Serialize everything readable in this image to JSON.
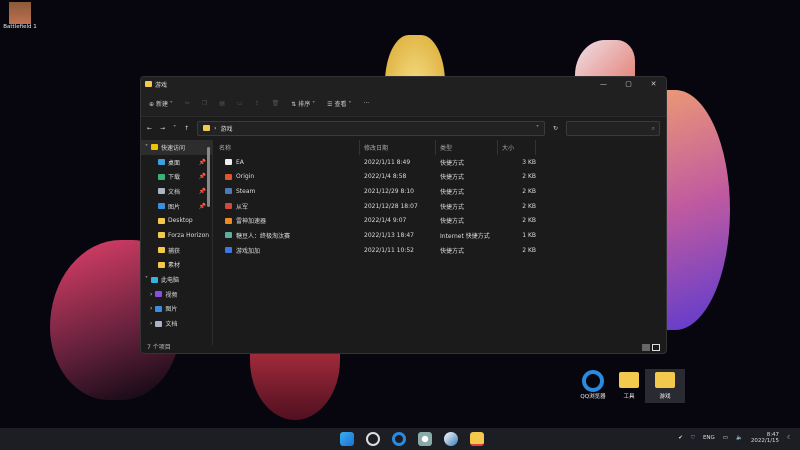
{
  "desktop": {
    "icons": [
      {
        "label": "Battlefield 1"
      },
      {
        "label": "QQ浏览器"
      },
      {
        "label": "工具"
      },
      {
        "label": "游戏"
      }
    ]
  },
  "window": {
    "title": "游戏",
    "controls": [
      "—",
      "▢",
      "✕"
    ]
  },
  "toolbar": {
    "new": "新建",
    "sort": "排序",
    "view": "查看",
    "more": "···"
  },
  "address": {
    "path": "游戏",
    "search_placeholder": ""
  },
  "sidebar": {
    "items": [
      {
        "label": "快速访问",
        "color": "#f2c200"
      },
      {
        "label": "桌面",
        "color": "#3aa0e0",
        "pin": true
      },
      {
        "label": "下载",
        "color": "#3ab07a",
        "pin": true
      },
      {
        "label": "文档",
        "color": "#aab4c8",
        "pin": true
      },
      {
        "label": "图片",
        "color": "#3a8ee0",
        "pin": true
      },
      {
        "label": "Desktop",
        "color": "#f2c94c"
      },
      {
        "label": "Forza Horizon",
        "color": "#f2c94c"
      },
      {
        "label": "捕获",
        "color": "#f2c94c"
      },
      {
        "label": "素材",
        "color": "#f2c94c"
      },
      {
        "label": "此电脑",
        "color": "#33b4e0"
      },
      {
        "label": "视频",
        "color": "#8a4ee0"
      },
      {
        "label": "图片",
        "color": "#3a8ee0"
      },
      {
        "label": "文档",
        "color": "#aab4c8"
      }
    ]
  },
  "columns": [
    "名称",
    "修改日期",
    "类型",
    "大小"
  ],
  "files": [
    {
      "name": "EA",
      "date": "2022/1/11 8:49",
      "type": "快捷方式",
      "size": "3 KB",
      "color": "#eeeeee"
    },
    {
      "name": "Origin",
      "date": "2022/1/4 8:58",
      "type": "快捷方式",
      "size": "2 KB",
      "color": "#e0552a"
    },
    {
      "name": "Steam",
      "date": "2021/12/29 8:10",
      "type": "快捷方式",
      "size": "2 KB",
      "color": "#4a7ab8"
    },
    {
      "name": "从军",
      "date": "2021/12/28 18:07",
      "type": "快捷方式",
      "size": "2 KB",
      "color": "#d04a3a"
    },
    {
      "name": "雷神加速器",
      "date": "2022/1/4 9:07",
      "type": "快捷方式",
      "size": "2 KB",
      "color": "#f08a1a"
    },
    {
      "name": "糖豆人：终极淘汰赛",
      "date": "2022/1/13 18:47",
      "type": "Internet 快捷方式",
      "size": "1 KB",
      "color": "#5ab0a0"
    },
    {
      "name": "游戏加加",
      "date": "2022/1/11 10:52",
      "type": "快捷方式",
      "size": "2 KB",
      "color": "#3a7ae0"
    }
  ],
  "status": "7 个项目",
  "tray": {
    "lang": "ENG",
    "time": "8:47",
    "date": "2022/1/15"
  }
}
